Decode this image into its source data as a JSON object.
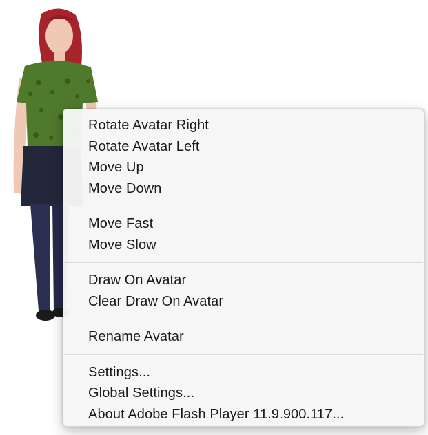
{
  "context_menu": {
    "groups": [
      {
        "items": [
          {
            "label": "Rotate Avatar Right"
          },
          {
            "label": "Rotate Avatar Left"
          },
          {
            "label": "Move Up"
          },
          {
            "label": "Move Down"
          }
        ]
      },
      {
        "items": [
          {
            "label": "Move Fast"
          },
          {
            "label": "Move Slow"
          }
        ]
      },
      {
        "items": [
          {
            "label": "Draw On Avatar"
          },
          {
            "label": "Clear Draw On Avatar"
          }
        ]
      },
      {
        "items": [
          {
            "label": "Rename Avatar"
          }
        ]
      },
      {
        "items": [
          {
            "label": "Settings..."
          },
          {
            "label": "Global Settings..."
          },
          {
            "label": "About Adobe Flash Player 11.9.900.117..."
          }
        ]
      }
    ]
  },
  "avatar": {
    "hair_color": "#a8242c",
    "shirt_color": "#4f7a2c",
    "skirt_color": "#22283a",
    "pants_color": "#2b2f52",
    "skin_color": "#f0c9b4"
  }
}
